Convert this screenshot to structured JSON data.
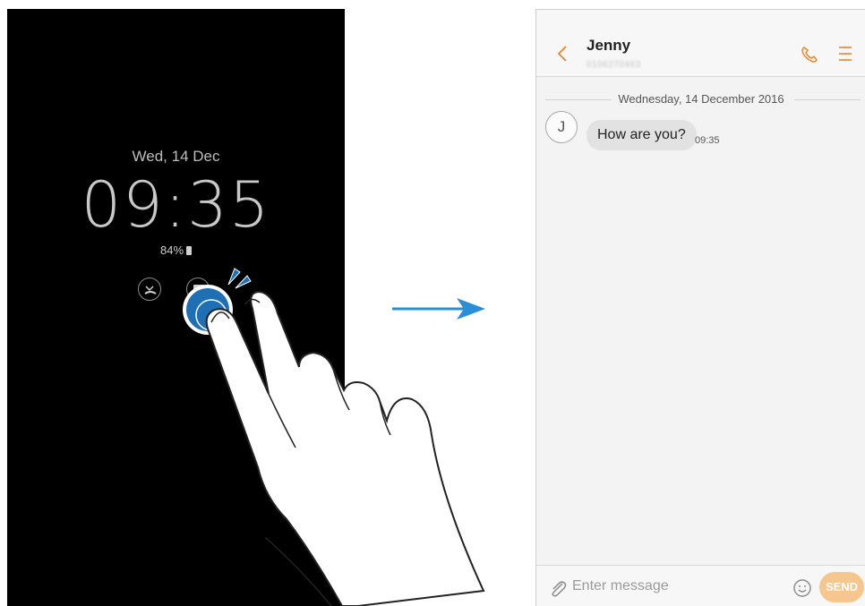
{
  "aod": {
    "date": "Wed, 14 Dec",
    "time": "09:35",
    "battery": "84%"
  },
  "chat": {
    "contact_name": "Jenny",
    "contact_number": "0106270463",
    "date_divider": "Wednesday, 14 December 2016",
    "avatar_letter": "J",
    "message_text": "How are you?",
    "message_time": "09:35",
    "input_placeholder": "Enter message",
    "send_label": "SEND"
  },
  "colors": {
    "accent": "#e8852a",
    "arrow": "#2a8fd6",
    "touch": "#1f6fb5",
    "send_bg": "#f6c68f"
  },
  "icons": {
    "back": "chevron-left-icon",
    "call": "phone-icon",
    "menu": "menu-icon",
    "attach": "paperclip-icon",
    "emoji": "smiley-icon",
    "missed_call": "missed-call-icon",
    "message": "message-icon"
  }
}
